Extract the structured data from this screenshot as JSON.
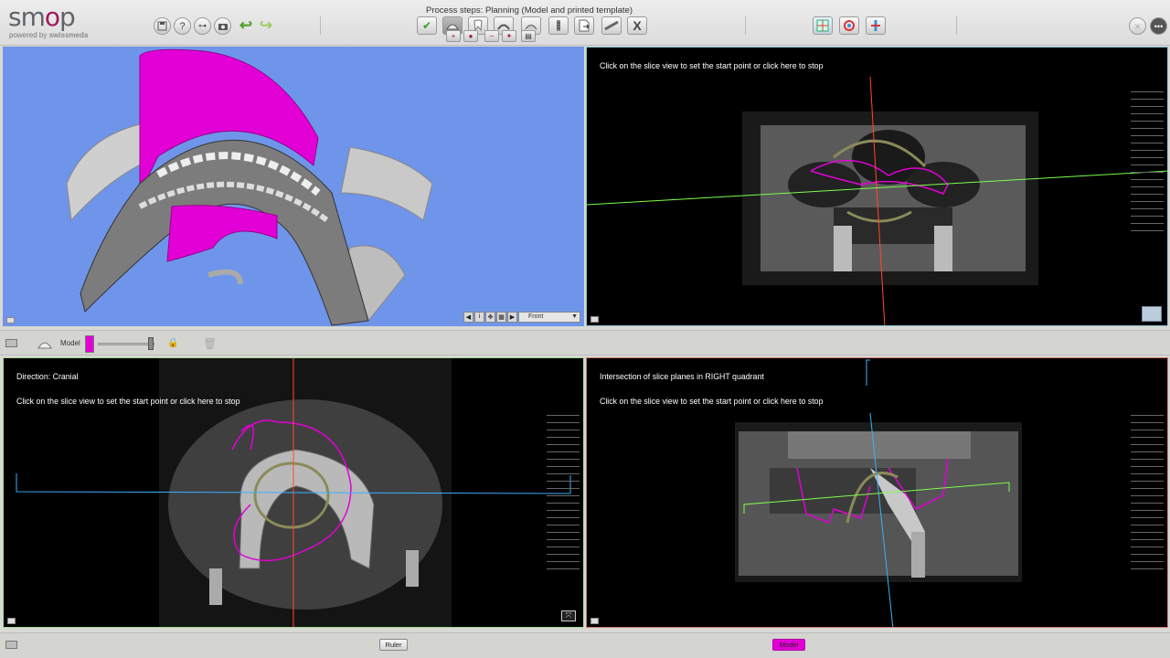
{
  "app": {
    "logo_text_pre": "sm",
    "logo_text_o": "o",
    "logo_text_post": "p",
    "powered_by": "powered by",
    "powered_brand": "swissmeda",
    "process_title": "Process steps: Planning (Model and printed template)"
  },
  "toolbar": {
    "left_buttons": [
      "save-icon",
      "help-icon",
      "glasses-icon",
      "camera-icon",
      "undo-arrow-icon",
      "redo-arrow-icon"
    ],
    "process_steps": [
      "check-icon",
      "model-icon",
      "tooth-icon",
      "template-icon",
      "implant-icon",
      "screw-icon",
      "export-icon",
      "print-icon",
      "close-step-icon"
    ],
    "process_step_last_label": "X",
    "right_tools": [
      "split-view-icon",
      "tooth-view-icon",
      "implant-view-icon"
    ]
  },
  "panels": {
    "three_d": {
      "view_select": "Front"
    },
    "coronal": {
      "instruction": "Click on the slice view to set the start point or click here to stop"
    },
    "axial": {
      "direction": "Direction: Cranial",
      "instruction": "Click on the slice view to set the start point or click here to stop"
    },
    "sagittal": {
      "title": "Intersection of slice planes in RIGHT quadrant",
      "instruction": "Click on the slice view to set the start point or click here to stop"
    }
  },
  "object_bar": {
    "label": "Model",
    "color": "#e200d6",
    "opacity_percent": 95
  },
  "bottom_bar": {
    "ruler_label": "Ruler",
    "model_label": "Model"
  },
  "colors": {
    "accent": "#a0195c",
    "model_magenta": "#e200d6",
    "axis_red": "#ff4a2a",
    "axis_green": "#7cff4a",
    "axis_blue": "#3ab0ff",
    "bg_3d": "#6e95e9"
  }
}
